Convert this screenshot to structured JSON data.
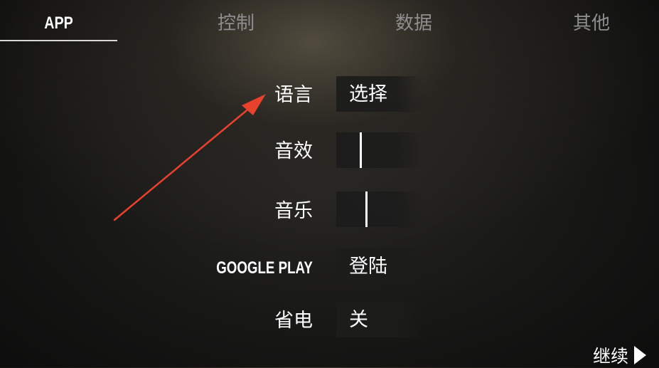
{
  "tabs": [
    {
      "label": "APP",
      "active": true
    },
    {
      "label": "控制",
      "active": false
    },
    {
      "label": "数据",
      "active": false
    },
    {
      "label": "其他",
      "active": false
    }
  ],
  "settings": {
    "language": {
      "label": "语言",
      "value": "选择"
    },
    "sound_effects": {
      "label": "音效",
      "level": 0.27
    },
    "music": {
      "label": "音乐",
      "level": 0.34
    },
    "google_play": {
      "label": "GOOGLE PLAY",
      "value": "登陆"
    },
    "power_saving": {
      "label": "省电",
      "value": "关"
    }
  },
  "footer": {
    "continue_label": "继续"
  },
  "annotation_color": "#e8412c",
  "icons": {
    "continue": "play-triangle-icon",
    "annotation": "red-arrow-icon"
  }
}
